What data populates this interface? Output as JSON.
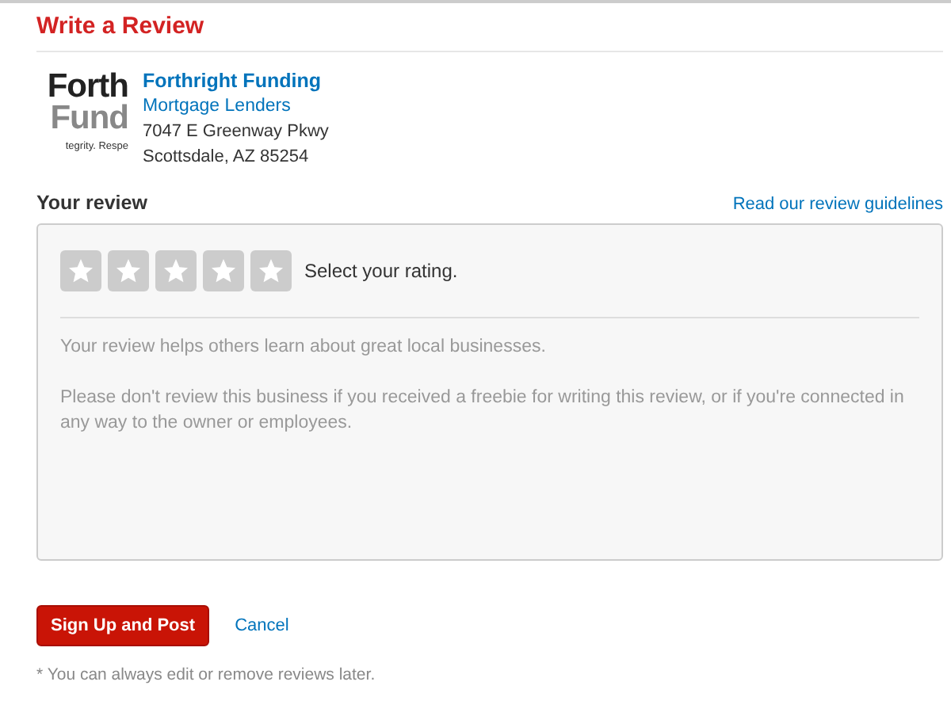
{
  "title": "Write a Review",
  "business": {
    "logo_lines": [
      "Forth",
      "Fund",
      "tegrity. Respe"
    ],
    "name": "Forthright Funding",
    "category": "Mortgage Lenders",
    "address": [
      "7047 E Greenway Pkwy",
      "Scottsdale, AZ 85254"
    ]
  },
  "review": {
    "label": "Your review",
    "guidelines_link": "Read our review guidelines",
    "stars": 0,
    "rating_prompt": "Select your rating.",
    "placeholder": [
      "Your review helps others learn about great local businesses.",
      "Please don't review this business if you received a freebie for writing this review, or if you're connected in any way to the owner or employees."
    ]
  },
  "buttons": {
    "post": "Sign Up and Post",
    "cancel": "Cancel"
  },
  "footnote": "* You can always edit or remove reviews later."
}
